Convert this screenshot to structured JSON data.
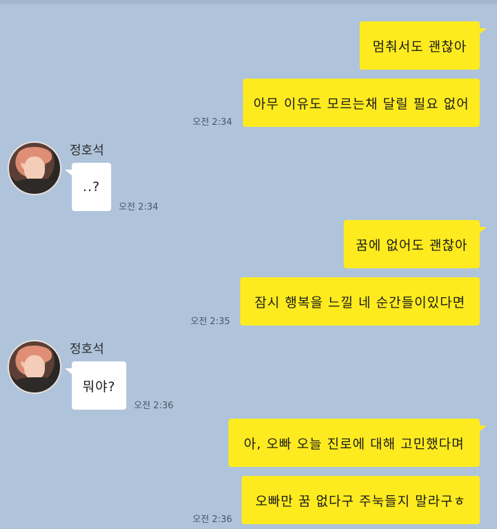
{
  "contact": {
    "name": "정호석"
  },
  "messages": [
    {
      "id": "m1",
      "side": "me",
      "text": "멈춰서도 괜찮아"
    },
    {
      "id": "m2",
      "side": "me",
      "text": "아무 이유도 모르는채 달릴 필요 없어",
      "time": "오전 2:34"
    },
    {
      "id": "m3",
      "side": "them",
      "text": "..?",
      "time": "오전 2:34"
    },
    {
      "id": "m4",
      "side": "me",
      "text": "꿈에 없어도 괜찮아"
    },
    {
      "id": "m5",
      "side": "me",
      "text": "잠시 행복을 느낄 네 순간들이있다면",
      "time": "오전 2:35"
    },
    {
      "id": "m6",
      "side": "them",
      "text": "뭐야?",
      "time": "오전 2:36"
    },
    {
      "id": "m7",
      "side": "me",
      "text": "아, 오빠 오늘 진로에 대해 고민했다며"
    },
    {
      "id": "m8",
      "side": "me",
      "text": "오빠만 꿈 없다구 주눅들지 말라구ㅎ",
      "time": "오전 2:36"
    }
  ],
  "colors": {
    "background": "#afc4db",
    "my_bubble": "#fdeb1f",
    "their_bubble": "#ffffff"
  }
}
